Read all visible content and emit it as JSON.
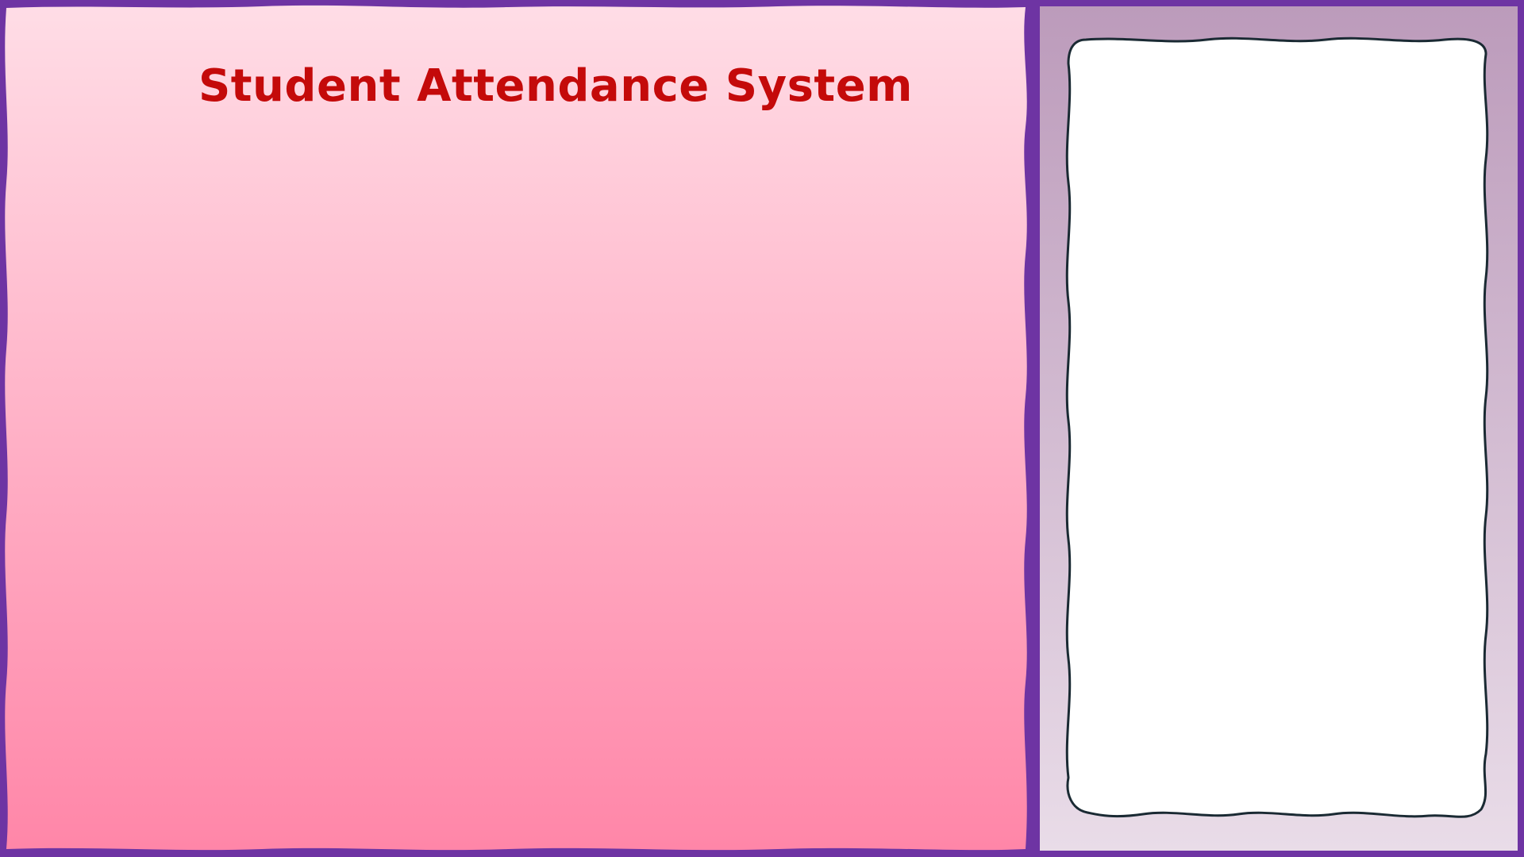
{
  "app": {
    "title": "Student Attendance System"
  },
  "colors": {
    "frame": "#6e34a3",
    "title": "#c40a0a",
    "main_gradient_top": "#ffdde6",
    "main_gradient_bottom": "#ff86a8",
    "side_gradient_top": "#bc9bbb",
    "side_gradient_bottom": "#e9dce8",
    "card_fill": "#ffffff",
    "card_stroke": "#1a2a33"
  }
}
